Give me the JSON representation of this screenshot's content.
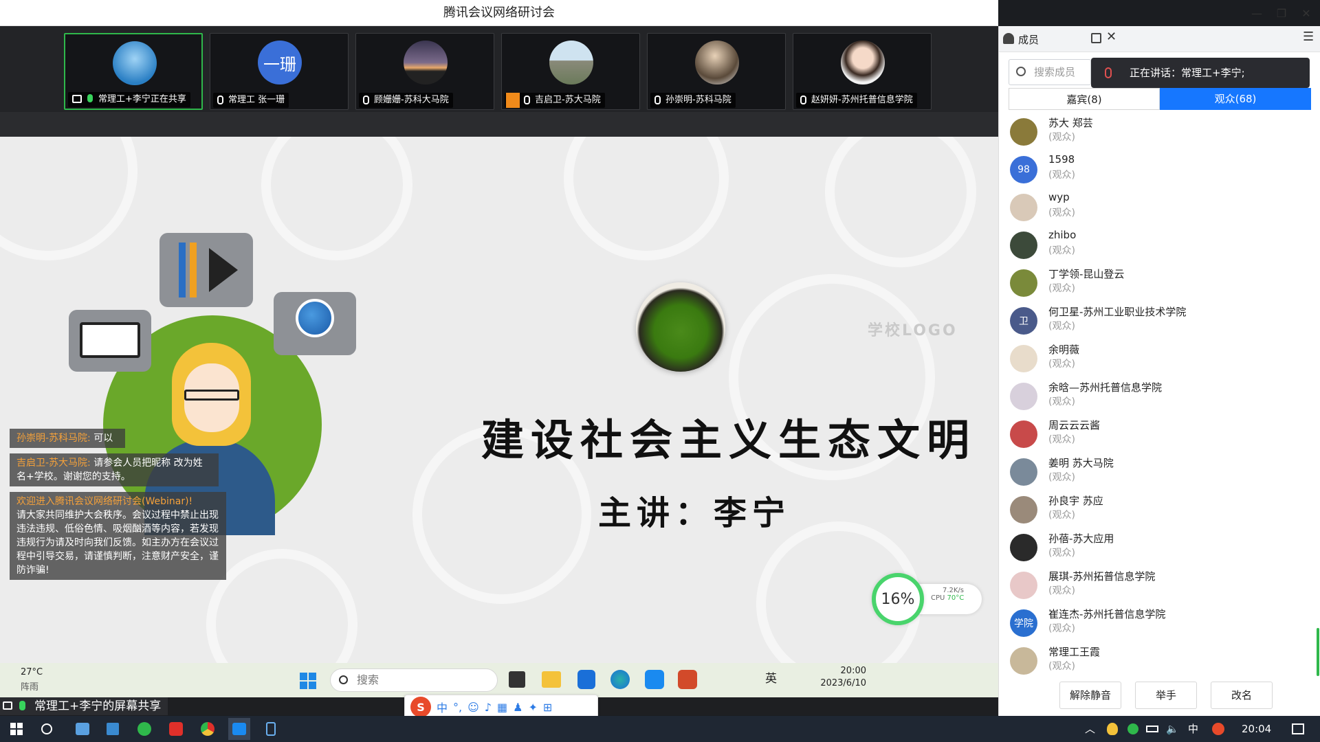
{
  "window": {
    "title": "腾讯会议网络研讨会",
    "minimize": "—",
    "restore": "❐",
    "close": "✕"
  },
  "participants_strip": [
    {
      "name": "常理工+李宁正在共享",
      "avatar": "sky-birds",
      "active": true,
      "sharing": true
    },
    {
      "name": "常理工 张一珊",
      "avatar_text": "一珊",
      "avatar_color": "#3a6fd8"
    },
    {
      "name": "顾姗姗-苏科大马院",
      "avatar": "sunset"
    },
    {
      "name": "吉启卫-苏大马院",
      "avatar": "buildings",
      "host_badge": true
    },
    {
      "name": "孙崇明-苏科马院",
      "avatar": "person-dog"
    },
    {
      "name": "赵妍妍-苏州托普信息学院",
      "avatar": "woman"
    }
  ],
  "slide": {
    "logo_placeholder": "学校LOGO",
    "title": "建设社会主义生态文明",
    "speaker": "主讲：李宁"
  },
  "chat_messages": [
    {
      "sender": "孙崇明-苏科马院:",
      "text": " 可以"
    },
    {
      "sender": "吉启卫-苏大马院:",
      "text": " 请参会人员把昵称 改为姓名+学校。谢谢您的支持。"
    },
    {
      "sender": "欢迎进入腾讯会议网络研讨会(Webinar)!",
      "text": "请大家共同维护大会秩序。会议过程中禁止出现违法违规、低俗色情、吸烟酗酒等内容，若发现违规行为请及时向我们反馈。如主办方在会议过程中引导交易，请谨慎判断，注意财产安全，谨防诈骗!"
    }
  ],
  "perf_widget": {
    "usage": "16%",
    "net": "7.2K/s",
    "cpu_label": "CPU",
    "cpu_temp": "70°C"
  },
  "inner_taskbar": {
    "weather_temp": "27°C",
    "weather_desc": "阵雨",
    "search_placeholder": "搜索",
    "lang": "英",
    "time": "20:00",
    "date": "2023/6/10"
  },
  "share_status": "常理工+李宁的屏幕共享",
  "ime_bar": {
    "mode": "中",
    "punct": "°,"
  },
  "panel": {
    "title": "成员",
    "search_placeholder": "搜索成员",
    "speaking": "正在讲话：常理工+李宁;",
    "tab_guests": "嘉宾(8)",
    "tab_audience": "观众(68)",
    "members": [
      {
        "name": "苏大 郑芸",
        "role": "(观众)",
        "avatar_color": "#8a7a3a"
      },
      {
        "name": "1598",
        "role": "(观众)",
        "avatar_text": "98",
        "avatar_color": "#3a6fd8"
      },
      {
        "name": "wyp",
        "role": "(观众)",
        "avatar_color": "#d9c9b8"
      },
      {
        "name": "zhibo",
        "role": "(观众)",
        "avatar_color": "#3c4a3a"
      },
      {
        "name": "丁学领-昆山登云",
        "role": "(观众)",
        "avatar_color": "#7a8a3a"
      },
      {
        "name": "何卫星-苏州工业职业技术学院",
        "role": "(观众)",
        "avatar_text": "卫",
        "avatar_color": "#4a5a8a"
      },
      {
        "name": "余明薇",
        "role": "(观众)",
        "avatar_color": "#e8dccb"
      },
      {
        "name": "余晗—苏州托普信息学院",
        "role": "(观众)",
        "avatar_color": "#d8d0dc"
      },
      {
        "name": "周云云云酱",
        "role": "(观众)",
        "avatar_color": "#c84a4a"
      },
      {
        "name": "姜明 苏大马院",
        "role": "(观众)",
        "avatar_color": "#7a8a9a"
      },
      {
        "name": "孙良宇  苏应",
        "role": "(观众)",
        "avatar_color": "#9a8a7a"
      },
      {
        "name": "孙蓓-苏大应用",
        "role": "(观众)",
        "avatar_color": "#2a2a2a"
      },
      {
        "name": "展琪-苏州拓普信息学院",
        "role": "(观众)",
        "avatar_color": "#e8c8c8"
      },
      {
        "name": "崔连杰-苏州托普信息学院",
        "role": "(观众)",
        "avatar_text": "学院",
        "avatar_color": "#2a6fd0"
      },
      {
        "name": "常理工王霞",
        "role": "(观众)",
        "avatar_color": "#c8b89a"
      }
    ],
    "btn_unmute": "解除静音",
    "btn_raise": "举手",
    "btn_rename": "改名"
  },
  "taskbar": {
    "time": "20:04",
    "ime": "中"
  },
  "colors": {
    "accent_blue": "#1677ff",
    "active_green": "#2fb84b",
    "chat_name": "#f5a13a",
    "slide_green": "#6aa82a"
  }
}
